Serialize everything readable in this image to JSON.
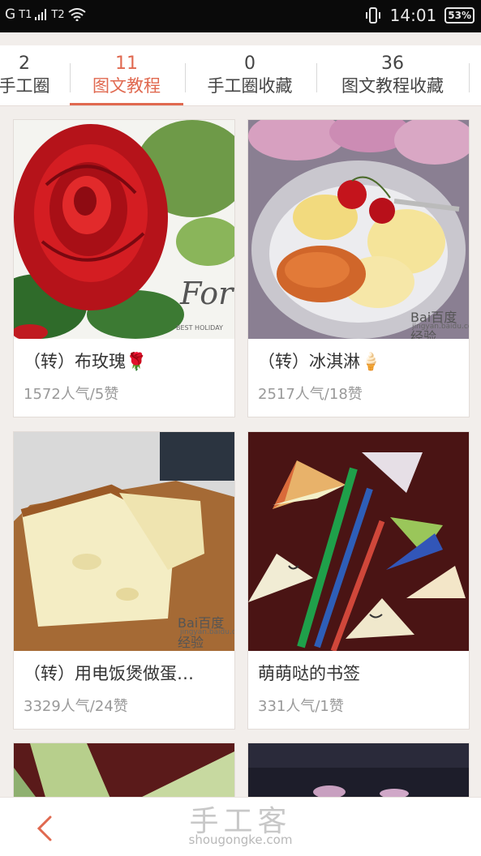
{
  "status_bar": {
    "carrier_1": "G",
    "sim_1": "T1",
    "sim_2": "T2",
    "time": "14:01",
    "battery": "53%"
  },
  "tabs": [
    {
      "count": "2",
      "label": "手工圈",
      "active": false
    },
    {
      "count": "11",
      "label": "图文教程",
      "active": true
    },
    {
      "count": "0",
      "label": "手工圈收藏",
      "active": false
    },
    {
      "count": "36",
      "label": "图文教程收藏",
      "active": false
    }
  ],
  "cards": [
    {
      "title": "（转）布玫瑰🌹",
      "meta": "1572人气/5赞",
      "image_caption": "For",
      "image_caption_small": "BEST HOLIDAY"
    },
    {
      "title": "（转）冰淇淋🍦",
      "meta": "2517人气/18赞",
      "image_caption": "Bai百度经验",
      "image_caption_small": "jingyan.baidu.com"
    },
    {
      "title": "（转）用电饭煲做蛋…",
      "meta": "3329人气/24赞",
      "image_caption": "Bai百度经验",
      "image_caption_small": "jingyan.baidu.com"
    },
    {
      "title": "萌萌哒的书签",
      "meta": "331人气/1赞"
    }
  ],
  "watermark": {
    "cn": "手工客",
    "en": "shougongke.com"
  },
  "colors": {
    "accent": "#e06950",
    "background": "#f2eeeb"
  },
  "icons": {
    "back": "chevron-left-icon",
    "wifi": "wifi-icon",
    "vibrate": "vibrate-icon",
    "signal": "signal-icon"
  }
}
